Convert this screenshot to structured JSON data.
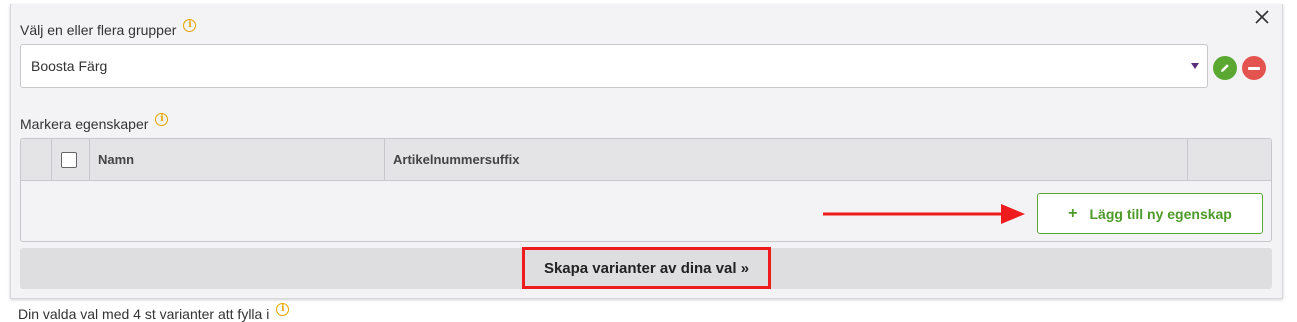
{
  "groups": {
    "label": "Välj en eller flera grupper",
    "selected": "Boosta Färg"
  },
  "properties": {
    "label": "Markera egenskaper",
    "columns": [
      "Namn",
      "Artikelnummersuffix"
    ],
    "add_label": "Lägg till ny egenskap",
    "add_icon": "+"
  },
  "submit_label": "Skapa varianter av dina val »",
  "footer_text": "Din valda val med 4 st varianter att fylla i",
  "icons": {
    "info": "i"
  },
  "colors": {
    "accent_green": "#5aa832",
    "remove_red": "#e3534f",
    "info_orange": "#e5a400",
    "highlight_red": "#ee1c1c"
  }
}
